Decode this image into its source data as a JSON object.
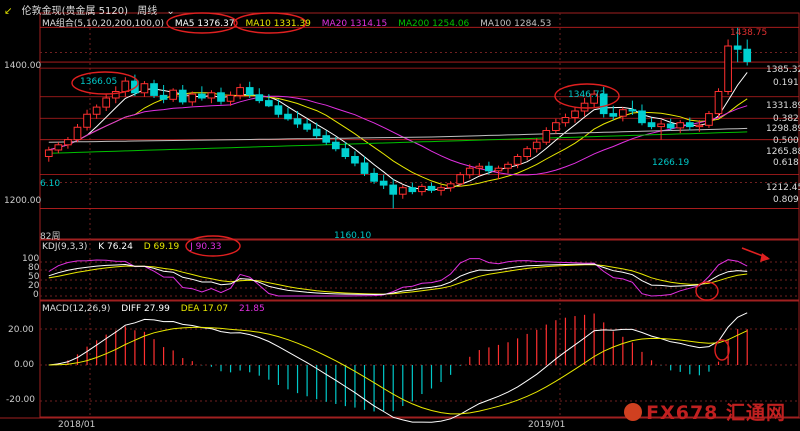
{
  "header": {
    "back_arrow": "↙",
    "title": "伦敦金现(贵金属 5120)",
    "period": "周线"
  },
  "ma": {
    "group_label": "MA组合(5,10,20,200,100,0)",
    "ma5": "MA5 1376.37",
    "ma10": "MA10 1331.39",
    "ma20": "MA20 1314.15",
    "ma200": "MA200 1254.06",
    "ma100": "MA100 1284.53",
    "colors": {
      "ma5": "#ffffff",
      "ma10": "#e8e800",
      "ma20": "#e030e0",
      "ma200": "#00c000",
      "ma100": "#c0c0c0"
    }
  },
  "kdj": {
    "label": "KDJ(9,3,3)",
    "k": "K 76.24",
    "d": "D 69.19",
    "j": "J 90.33"
  },
  "macd": {
    "label": "MACD(12,26,9)",
    "diff": "DIFF 27.99",
    "dea": "DEA 17.07",
    "macd": "21.85"
  },
  "price_axis": {
    "p1400": "1400.00",
    "p1200": "1200.00"
  },
  "fib_levels": {
    "l1385": "1385.32",
    "l0191": "0.191",
    "l1331": "1331.89",
    "l0382": "0.382",
    "l1298": "1298.89",
    "l0500": "0.500",
    "l1265": "1265.88",
    "l0618": "0.618",
    "l1212": "1212.45",
    "l0809": "0.809"
  },
  "annotations": {
    "high": "1438.75",
    "a1366": "1366.05",
    "a1346": "1346.73",
    "a1266": "1266.19",
    "a1160": "1160.10",
    "left_val": "6.10",
    "week_count": "82周"
  },
  "kdj_axis": {
    "t100": "100",
    "t80": "80",
    "t50": "50",
    "t20": "20",
    "t0": "0"
  },
  "macd_axis": {
    "t20": "20.00",
    "t0": "0.00",
    "tm20": "-20.00"
  },
  "time_axis": {
    "t2018": "2018/01",
    "t2019": "2019/01"
  },
  "watermark": {
    "text": "FX678 汇通网"
  },
  "chart_data": {
    "type": "candlestick",
    "timeframe": "weekly",
    "y_range": [
      1150,
      1450
    ],
    "candles": [
      [
        1240,
        1255,
        1232,
        1250
      ],
      [
        1250,
        1262,
        1245,
        1258
      ],
      [
        1258,
        1270,
        1252,
        1266
      ],
      [
        1266,
        1290,
        1262,
        1285
      ],
      [
        1285,
        1312,
        1280,
        1305
      ],
      [
        1305,
        1320,
        1298,
        1316
      ],
      [
        1316,
        1336,
        1310,
        1330
      ],
      [
        1330,
        1348,
        1322,
        1340
      ],
      [
        1340,
        1362,
        1332,
        1356
      ],
      [
        1356,
        1366,
        1333,
        1338
      ],
      [
        1338,
        1356,
        1332,
        1352
      ],
      [
        1352,
        1358,
        1330,
        1334
      ],
      [
        1334,
        1350,
        1322,
        1328
      ],
      [
        1328,
        1345,
        1324,
        1342
      ],
      [
        1342,
        1350,
        1320,
        1324
      ],
      [
        1324,
        1340,
        1318,
        1336
      ],
      [
        1336,
        1348,
        1326,
        1330
      ],
      [
        1330,
        1342,
        1322,
        1338
      ],
      [
        1338,
        1346,
        1320,
        1325
      ],
      [
        1325,
        1340,
        1318,
        1334
      ],
      [
        1334,
        1352,
        1328,
        1346
      ],
      [
        1346,
        1355,
        1330,
        1335
      ],
      [
        1335,
        1345,
        1322,
        1326
      ],
      [
        1326,
        1336,
        1316,
        1318
      ],
      [
        1318,
        1328,
        1300,
        1305
      ],
      [
        1305,
        1315,
        1295,
        1298
      ],
      [
        1298,
        1310,
        1284,
        1290
      ],
      [
        1290,
        1298,
        1278,
        1282
      ],
      [
        1282,
        1292,
        1268,
        1272
      ],
      [
        1272,
        1280,
        1258,
        1262
      ],
      [
        1262,
        1270,
        1248,
        1252
      ],
      [
        1252,
        1262,
        1236,
        1240
      ],
      [
        1240,
        1248,
        1225,
        1230
      ],
      [
        1230,
        1240,
        1210,
        1214
      ],
      [
        1214,
        1222,
        1198,
        1202
      ],
      [
        1202,
        1212,
        1190,
        1196
      ],
      [
        1196,
        1205,
        1160,
        1182
      ],
      [
        1182,
        1196,
        1175,
        1192
      ],
      [
        1192,
        1200,
        1182,
        1186
      ],
      [
        1186,
        1198,
        1180,
        1194
      ],
      [
        1194,
        1200,
        1184,
        1188
      ],
      [
        1188,
        1196,
        1180,
        1192
      ],
      [
        1192,
        1202,
        1186,
        1198
      ],
      [
        1198,
        1216,
        1194,
        1212
      ],
      [
        1212,
        1228,
        1206,
        1222
      ],
      [
        1222,
        1230,
        1210,
        1225
      ],
      [
        1225,
        1232,
        1212,
        1218
      ],
      [
        1218,
        1226,
        1205,
        1222
      ],
      [
        1222,
        1232,
        1214,
        1228
      ],
      [
        1228,
        1244,
        1222,
        1240
      ],
      [
        1240,
        1256,
        1234,
        1252
      ],
      [
        1252,
        1268,
        1246,
        1262
      ],
      [
        1262,
        1285,
        1258,
        1280
      ],
      [
        1280,
        1298,
        1275,
        1292
      ],
      [
        1292,
        1306,
        1286,
        1300
      ],
      [
        1300,
        1316,
        1292,
        1310
      ],
      [
        1310,
        1330,
        1302,
        1322
      ],
      [
        1322,
        1342,
        1316,
        1336
      ],
      [
        1336,
        1347,
        1300,
        1306
      ],
      [
        1306,
        1318,
        1296,
        1302
      ],
      [
        1302,
        1316,
        1294,
        1312
      ],
      [
        1312,
        1326,
        1304,
        1310
      ],
      [
        1310,
        1320,
        1288,
        1292
      ],
      [
        1292,
        1300,
        1282,
        1286
      ],
      [
        1286,
        1296,
        1266,
        1290
      ],
      [
        1290,
        1298,
        1280,
        1284
      ],
      [
        1284,
        1296,
        1276,
        1292
      ],
      [
        1292,
        1300,
        1280,
        1286
      ],
      [
        1286,
        1296,
        1278,
        1288
      ],
      [
        1288,
        1310,
        1284,
        1306
      ],
      [
        1306,
        1345,
        1300,
        1340
      ],
      [
        1340,
        1420,
        1335,
        1410
      ],
      [
        1410,
        1438,
        1385,
        1405
      ],
      [
        1405,
        1420,
        1380,
        1386
      ]
    ]
  }
}
